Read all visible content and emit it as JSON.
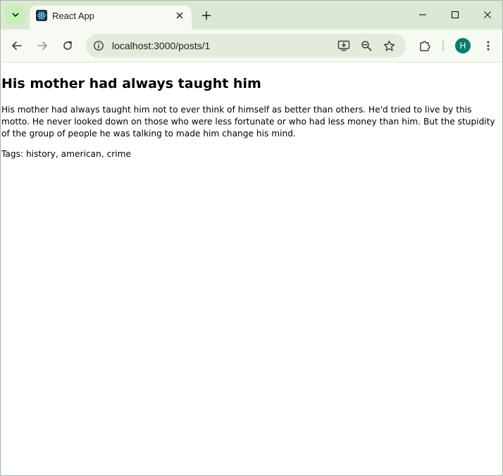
{
  "browser": {
    "tab": {
      "title": "React App",
      "favicon": "react-icon"
    },
    "address_bar": {
      "url": "localhost:3000/posts/1"
    },
    "profile": {
      "initial": "H",
      "color": "#0a7d69"
    },
    "icons": {
      "tab_search": "chevron-down-icon",
      "close_tab": "close-icon",
      "new_tab": "plus-icon",
      "minimize": "minimize-icon",
      "maximize": "maximize-icon",
      "close_window": "close-icon",
      "back": "arrow-left-icon",
      "forward": "arrow-right-icon",
      "reload": "reload-icon",
      "site_info": "info-icon",
      "install": "install-app-icon",
      "zoom": "zoom-out-icon",
      "bookmark": "star-icon",
      "extensions": "puzzle-icon",
      "menu": "kebab-menu-icon"
    }
  },
  "post": {
    "title": "His mother had always taught him",
    "body": "His mother had always taught him not to ever think of himself as better than others. He'd tried to live by this motto. He never looked down on those who were less fortunate or who had less money than him. But the stupidity of the group of people he was talking to made him change his mind.",
    "tags_line": "Tags: history, american, crime"
  }
}
